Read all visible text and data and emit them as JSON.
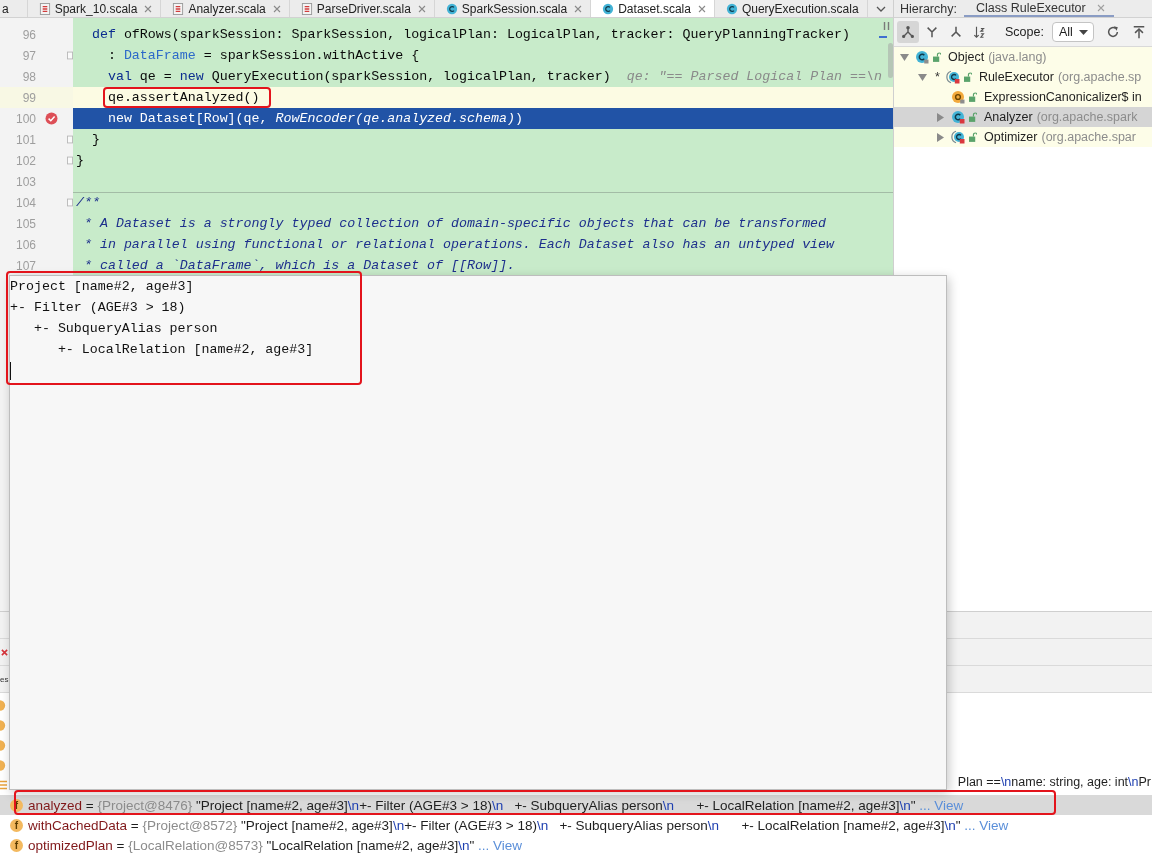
{
  "editor": {
    "tabs": [
      {
        "label": "a",
        "kind": "cut",
        "selected": false
      },
      {
        "label": "Spark_10.scala",
        "kind": "scala-file",
        "selected": false
      },
      {
        "label": "Analyzer.scala",
        "kind": "scala-file",
        "selected": false
      },
      {
        "label": "ParseDriver.scala",
        "kind": "scala-file",
        "selected": false
      },
      {
        "label": "SparkSession.scala",
        "kind": "class",
        "selected": false
      },
      {
        "label": "Dataset.scala",
        "kind": "class",
        "selected": true
      },
      {
        "label": "QueryExecution.scala",
        "kind": "class",
        "selected": false
      }
    ],
    "lines": [
      {
        "number": "96",
        "segments": [
          {
            "kind": "keyword",
            "text": "  def"
          },
          {
            "kind": "plain",
            "text": " ofRows(sparkSession: SparkSession, logicalPlan: LogicalPlan, tracker: QueryPlanningTracker)"
          }
        ],
        "current": false,
        "selected": false,
        "breakpoint": false,
        "fold": false,
        "separator": false,
        "boxed": false
      },
      {
        "number": "97",
        "segments": [
          {
            "kind": "plain",
            "text": "    : "
          },
          {
            "kind": "type",
            "text": "DataFrame"
          },
          {
            "kind": "plain",
            "text": " = sparkSession.withActive {"
          }
        ],
        "current": false,
        "selected": false,
        "breakpoint": false,
        "fold": true,
        "separator": false,
        "boxed": false
      },
      {
        "number": "98",
        "segments": [
          {
            "kind": "keyword",
            "text": "    val"
          },
          {
            "kind": "plain",
            "text": " qe = "
          },
          {
            "kind": "keyword",
            "text": "new"
          },
          {
            "kind": "plain",
            "text": " QueryExecution(sparkSession, logicalPlan, tracker)"
          }
        ],
        "hint": "qe: \"== Parsed Logical Plan ==\\n",
        "current": false,
        "selected": false,
        "breakpoint": false,
        "fold": false,
        "separator": false,
        "boxed": false
      },
      {
        "number": "99",
        "segments": [
          {
            "kind": "plain",
            "text": "    qe.assertAnalyzed()"
          }
        ],
        "current": true,
        "selected": false,
        "breakpoint": false,
        "fold": false,
        "separator": false,
        "boxed": true
      },
      {
        "number": "100",
        "segments": [
          {
            "kind": "keyword",
            "text": "    new"
          },
          {
            "kind": "plain",
            "text": " Dataset[Row](qe, "
          },
          {
            "kind": "italic",
            "text": "RowEncoder(qe.analyzed.schema)"
          },
          {
            "kind": "plain",
            "text": ")"
          }
        ],
        "current": false,
        "selected": true,
        "breakpoint": true,
        "fold": false,
        "separator": false,
        "boxed": false
      },
      {
        "number": "101",
        "segments": [
          {
            "kind": "plain",
            "text": "  }"
          }
        ],
        "current": false,
        "selected": false,
        "breakpoint": false,
        "fold": true,
        "separator": false,
        "boxed": false
      },
      {
        "number": "102",
        "segments": [
          {
            "kind": "plain",
            "text": "}"
          }
        ],
        "current": false,
        "selected": false,
        "breakpoint": false,
        "fold": true,
        "separator": false,
        "boxed": false
      },
      {
        "number": "103",
        "current": false,
        "selected": false,
        "breakpoint": false,
        "fold": false,
        "separator": false,
        "boxed": false
      },
      {
        "number": "104",
        "segments": [
          {
            "kind": "comment",
            "text": "/**"
          }
        ],
        "current": false,
        "selected": false,
        "breakpoint": false,
        "fold": true,
        "separator": true,
        "boxed": false
      },
      {
        "number": "105",
        "segments": [
          {
            "kind": "comment",
            "text": " * A Dataset is a strongly typed collection of domain-specific objects that can be transformed"
          }
        ],
        "current": false,
        "selected": false,
        "breakpoint": false,
        "fold": false,
        "separator": false,
        "boxed": false
      },
      {
        "number": "106",
        "segments": [
          {
            "kind": "comment",
            "text": " * in parallel using functional or relational operations. Each Dataset also has an untyped view"
          }
        ],
        "current": false,
        "selected": false,
        "breakpoint": false,
        "fold": false,
        "separator": false,
        "boxed": false
      },
      {
        "number": "107",
        "segments": [
          {
            "kind": "comment",
            "text": " * called a `DataFrame`, which is a Dataset of [[Row]]."
          }
        ],
        "current": false,
        "selected": false,
        "breakpoint": false,
        "fold": false,
        "separator": false,
        "boxed": false
      }
    ]
  },
  "hierarchy": {
    "title": "Hierarchy:",
    "tab": {
      "label": "Class RuleExecutor",
      "selected": true
    },
    "view_buttons": [
      {
        "kind": "hierarchy",
        "pressed": true
      },
      {
        "kind": "subtypes",
        "pressed": false
      },
      {
        "kind": "supertypes",
        "pressed": false
      },
      {
        "kind": "sort",
        "pressed": false
      }
    ],
    "scope_label": "Scope:",
    "scope_value": "All",
    "tree": [
      {
        "name": "Object",
        "package": "(java.lang)",
        "kind": "library-class",
        "expanded": true,
        "selected": false,
        "children": [
          {
            "name": "RuleExecutor",
            "package": "(org.apache.sp",
            "marker": "*",
            "kind": "abstract-class",
            "expanded": true,
            "selected": false,
            "children": [
              {
                "name": "ExpressionCanonicalizer$ in",
                "kind": "object",
                "selected": false
              },
              {
                "name": "Analyzer",
                "package": "(org.apache.spark",
                "kind": "class",
                "expanded": false,
                "selected": true
              },
              {
                "name": "Optimizer",
                "package": "(org.apache.spar",
                "kind": "abstract-class",
                "expanded": false,
                "selected": false
              }
            ]
          }
        ]
      }
    ]
  },
  "value_popup": {
    "lines": [
      "Project [name#2, age#3]",
      "+- Filter (AGE#3 > 18)",
      "   +- SubqueryAlias person",
      "      +- LocalRelation [name#2, age#3]"
    ],
    "boxed": true
  },
  "debugger": {
    "tab_fragment": "es",
    "row_tail": [
      {
        "kind": "plain",
        "text": "Plan =="
      },
      {
        "kind": "escape",
        "text": "\\n"
      },
      {
        "kind": "plain",
        "text": "name: string, age: int"
      },
      {
        "kind": "escape",
        "text": "\\n"
      },
      {
        "kind": "plain",
        "text": "Pr"
      }
    ],
    "variables": [
      {
        "icon": "f",
        "selected": true,
        "boxed": true,
        "segments": [
          {
            "kind": "name",
            "text": "analyzed"
          },
          {
            "kind": "plain",
            "text": " = "
          },
          {
            "kind": "type",
            "text": "{Project@8476}"
          },
          {
            "kind": "plain",
            "text": " \"Project [name#2, age#3]"
          },
          {
            "kind": "escape",
            "text": "\\n"
          },
          {
            "kind": "plain",
            "text": "+- Filter (AGE#3 > 18)"
          },
          {
            "kind": "escape",
            "text": "\\n"
          },
          {
            "kind": "plain",
            "text": "   +- SubqueryAlias person"
          },
          {
            "kind": "escape",
            "text": "\\n"
          },
          {
            "kind": "plain",
            "text": "      +- LocalRelation [name#2, age#3]"
          },
          {
            "kind": "escape",
            "text": "\\n"
          },
          {
            "kind": "plain",
            "text": "\" "
          },
          {
            "kind": "link",
            "text": "... View"
          }
        ]
      },
      {
        "icon": "f",
        "selected": false,
        "boxed": false,
        "segments": [
          {
            "kind": "name",
            "text": "withCachedData"
          },
          {
            "kind": "plain",
            "text": " = "
          },
          {
            "kind": "type",
            "text": "{Project@8572}"
          },
          {
            "kind": "plain",
            "text": " \"Project [name#2, age#3]"
          },
          {
            "kind": "escape",
            "text": "\\n"
          },
          {
            "kind": "plain",
            "text": "+- Filter (AGE#3 > 18)"
          },
          {
            "kind": "escape",
            "text": "\\n"
          },
          {
            "kind": "plain",
            "text": "   +- SubqueryAlias person"
          },
          {
            "kind": "escape",
            "text": "\\n"
          },
          {
            "kind": "plain",
            "text": "      +- LocalRelation [name#2, age#3]"
          },
          {
            "kind": "escape",
            "text": "\\n"
          },
          {
            "kind": "plain",
            "text": "\" "
          },
          {
            "kind": "link",
            "text": "... View"
          }
        ]
      },
      {
        "icon": "f",
        "selected": false,
        "boxed": false,
        "segments": [
          {
            "kind": "name",
            "text": "optimizedPlan"
          },
          {
            "kind": "plain",
            "text": " = "
          },
          {
            "kind": "type",
            "text": "{LocalRelation@8573}"
          },
          {
            "kind": "plain",
            "text": " \"LocalRelation [name#2, age#3]"
          },
          {
            "kind": "escape",
            "text": "\\n"
          },
          {
            "kind": "plain",
            "text": "\" "
          },
          {
            "kind": "link",
            "text": "... View"
          }
        ]
      }
    ]
  }
}
